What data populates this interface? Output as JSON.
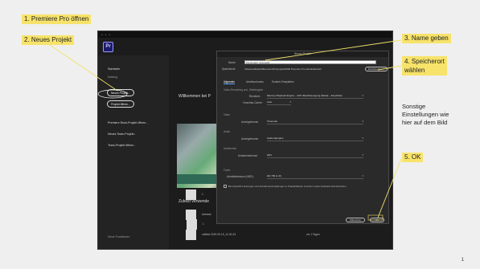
{
  "slide": {
    "page_number": "1",
    "callouts": {
      "step1": "1. Premiere Pro öffnen",
      "step2": "2. Neues Projekt",
      "step3": "3. Name geben",
      "step4_line1": "4. Speicherort",
      "step4_line2": "wählen",
      "step5": "5. OK"
    },
    "note": {
      "line1": "Sonstige",
      "line2": "Einstellungen wie",
      "line3": "hier auf dem Bild"
    },
    "callout_color": "#f7e36a"
  },
  "premiere": {
    "logo": "Pr",
    "welcome": "Willkommen bei P",
    "recent_heading": "Zuletzt verwende",
    "sidebar": {
      "items": [
        {
          "label": "Startseite"
        },
        {
          "label": "Katalog"
        }
      ],
      "new_project": "Neues Projekt...",
      "open_project": "Projekt öffnen...",
      "links": [
        {
          "label": "Premiere Rush-Projekt öffnen..."
        },
        {
          "label": "Neues Team-Projekt..."
        },
        {
          "label": "Team-Projekt öffnen..."
        }
      ],
      "footer": "Neue Funktionen"
    },
    "recent": {
      "column_name": "Name",
      "rows": [
        {
          "name": "1",
          "date": ""
        },
        {
          "name": "Adresse",
          "date": ""
        },
        {
          "name": "untitled 2020-09-15_12-40-43",
          "date": "vor 1 Tagen"
        }
      ]
    }
  },
  "dialog": {
    "title": "Neues Projekt",
    "name_label": "Name:",
    "name_value": "Filmprojekt_Gruppe01",
    "location_label": "Speicherort:",
    "location_value": "/Volumes/Daten/Benutzer/Filmprojekt/2020 Premiere Pro-Arbeitsbereich",
    "browse_button": "Durchsuchen...",
    "tabs": [
      {
        "label": "Allgemein"
      },
      {
        "label": "Arbeitsvolumes"
      },
      {
        "label": "Scratch-Festplatten"
      }
    ],
    "sections": {
      "video_rendering": "Video-Rendering und -Wiedergabe",
      "video": "Video",
      "audio": "Audio",
      "capture": "Aufnehmen",
      "tracking": "Projektelemente"
    },
    "fields": {
      "renderer_label": "Renderer:",
      "renderer_value": "Mercury Playback Engine – GPU-Beschleunigung (Metal) – Empfohlen",
      "preview_cache": "Vorschau-Cache:",
      "preview_cache_value": "Auto",
      "display_format_label": "Anzeigeformat:",
      "display_format_value": "Timecode",
      "audio_format_label": "Anzeigeformat:",
      "audio_format_value": "Audio-Samples",
      "capture_format_label": "Aufnahmeformat:",
      "capture_format_value": "HDV",
      "color_label": "Farbe",
      "color_space_label": "Arbeitsfarbraum (HDR):",
      "color_space_value": "HD 709 (L-R)",
      "include_label": "Bei Auswahl Lenkungen und Aufnahmeeinstellungen in Projektdateien ersetzen sowie Audiolink überschreiben"
    },
    "cancel_button": "Abbrechen",
    "ok_button": "OK"
  }
}
